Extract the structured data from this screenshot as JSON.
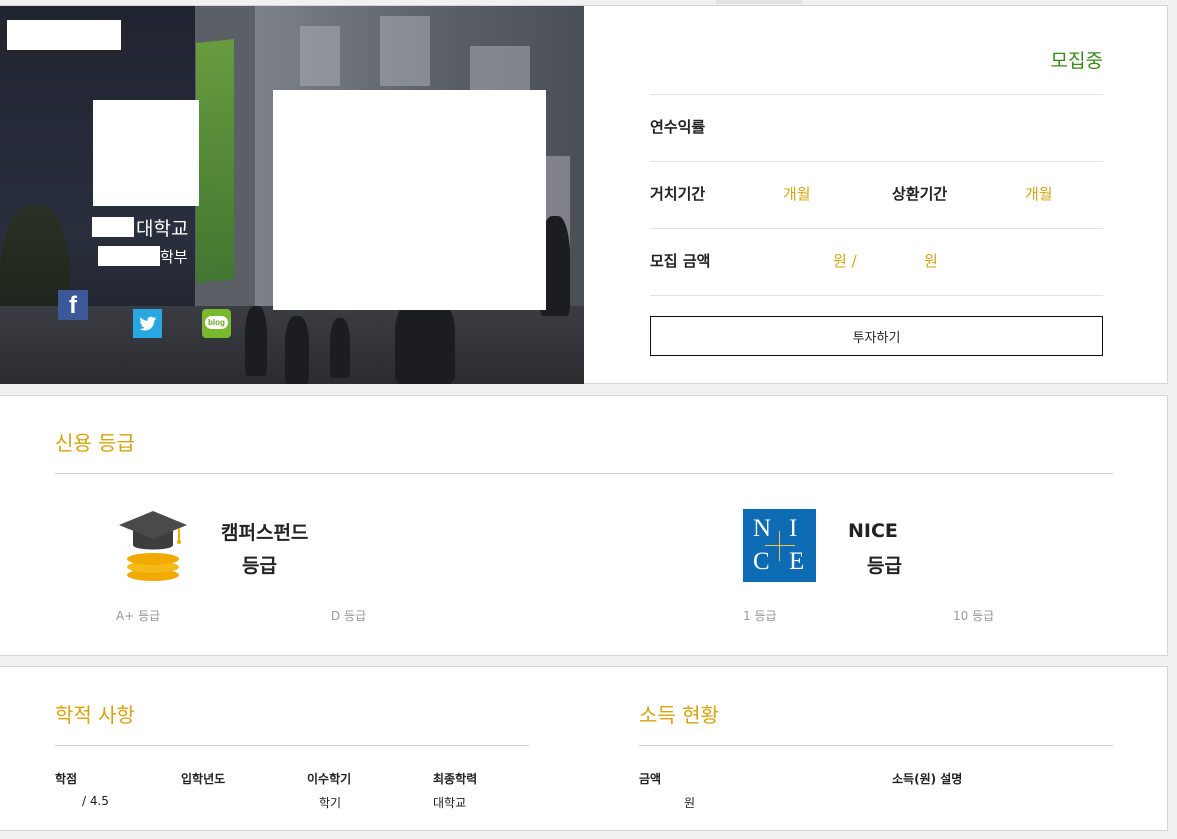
{
  "hero": {
    "university_suffix": "대학교",
    "department_suffix": "학부"
  },
  "icons": {
    "facebook": "facebook-icon",
    "twitter": "twitter-icon",
    "blog": "blog-icon",
    "blog_text": "blog"
  },
  "info": {
    "status": "모집중",
    "annual_return_label": "연수익률",
    "grace_period_label": "거치기간",
    "grace_period_unit": "개월",
    "repay_period_label": "상환기간",
    "repay_period_unit": "개월",
    "amount_label": "모집 금액",
    "amount_current_unit": "원 /",
    "amount_target_unit": "원",
    "invest_button": "투자하기"
  },
  "credit": {
    "title": "신용 등급",
    "campus": {
      "name": "캠퍼스펀드",
      "grade_suffix": "등급",
      "scale_high": "A+ 등급",
      "scale_low": "D 등급"
    },
    "nice": {
      "name": "NICE",
      "logo_letters": [
        "N",
        "I",
        "C",
        "E"
      ],
      "grade_suffix": "등급",
      "scale_high": "1 등급",
      "scale_low": "10 등급"
    }
  },
  "academic": {
    "title": "학적 사항",
    "columns": [
      "학점",
      "입학년도",
      "이수학기",
      "최종학력"
    ],
    "values": [
      "/ 4.5",
      "",
      "학기",
      "대학교"
    ]
  },
  "income": {
    "title": "소득 현황",
    "columns": [
      "금액",
      "소득(원) 설명"
    ],
    "values": [
      "원",
      ""
    ]
  },
  "colors": {
    "accent_gold": "#d7a30e",
    "status_green": "#3a8a1a",
    "nice_blue": "#0d6cb3"
  }
}
